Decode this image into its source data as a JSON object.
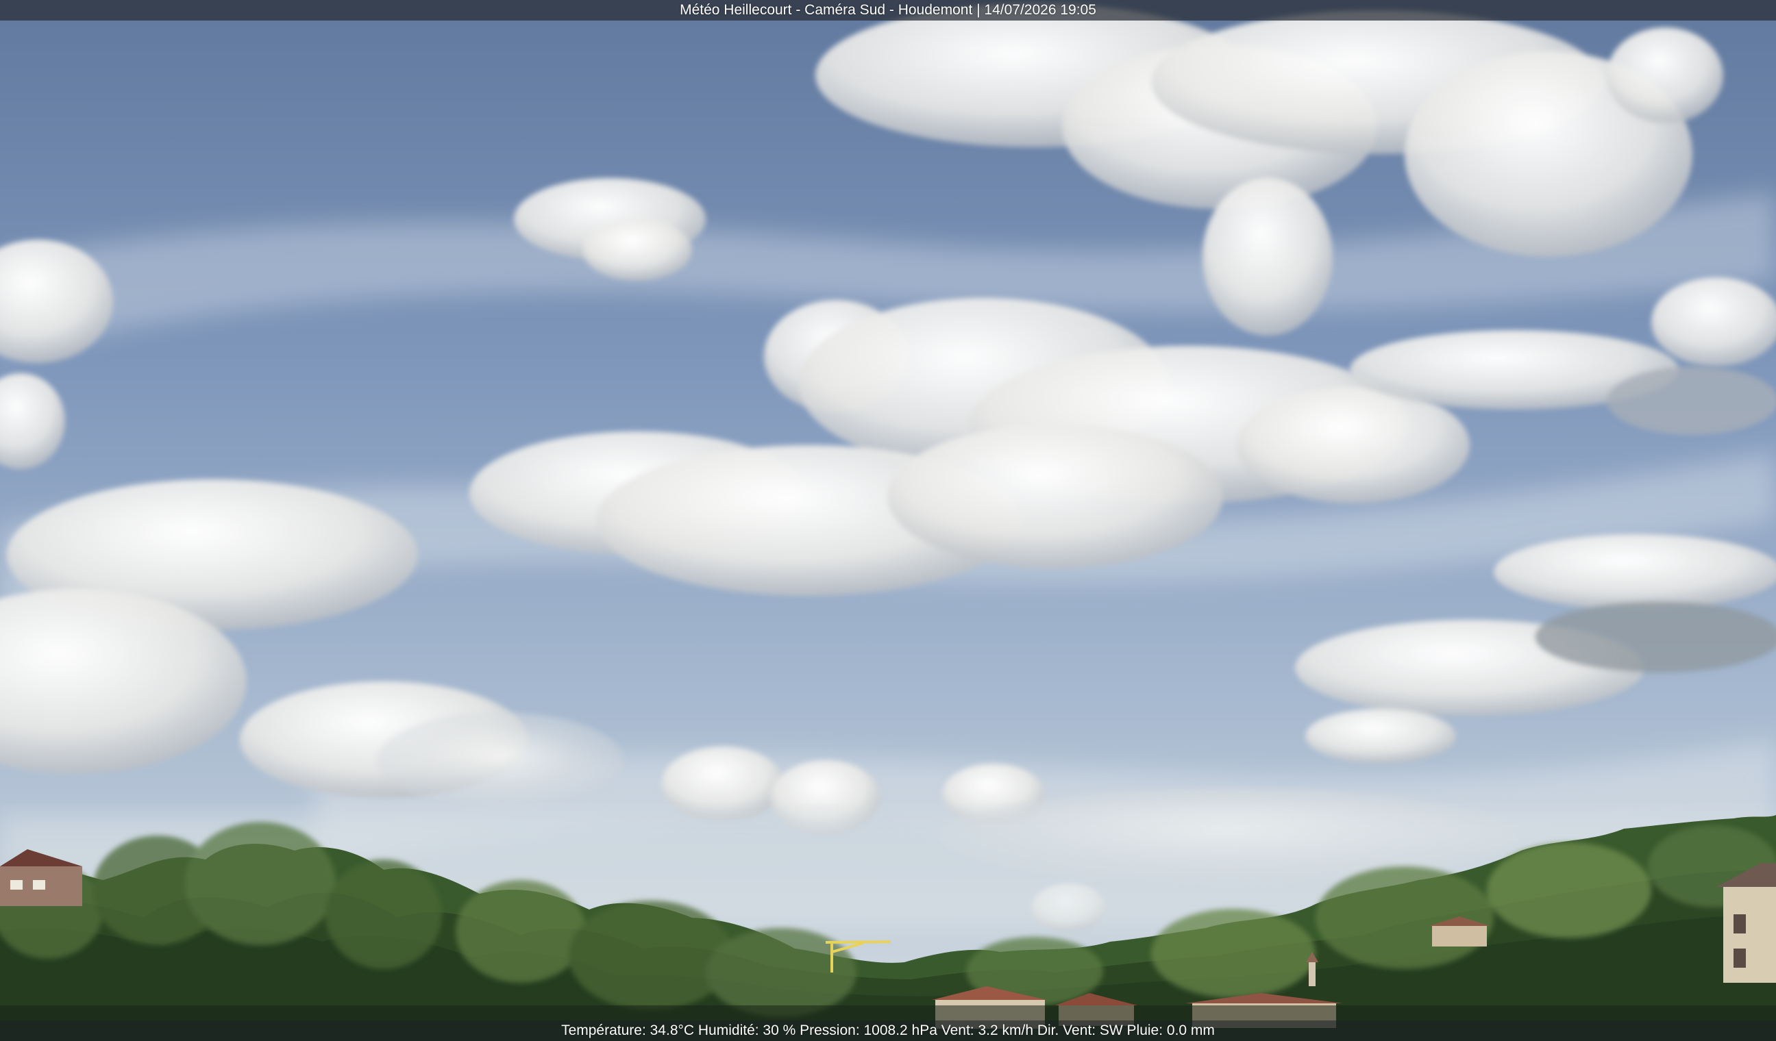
{
  "overlay": {
    "title": "Météo Heillecourt - Caméra Sud - Houdemont | 14/07/2026 19:05",
    "weather_line": "Température: 34.8°C  Humidité: 30 % Pression: 1008.2 hPa Vent: 3.2 km/h Dir. Vent: SW Pluie: 0.0 mm"
  },
  "scene": {
    "sky_top": "#6d84a8",
    "sky_mid": "#93a9c6",
    "sky_horizon": "#c9d3dc",
    "cloud_light": "#f1f1ee",
    "cloud_shadow": "#9ea3aa",
    "hill_dark": "#2f4a25",
    "hill_mid": "#4d6e36",
    "hill_light": "#7a9a4f",
    "roof_red": "#9b5a45",
    "wall_light": "#d9cbb0"
  }
}
